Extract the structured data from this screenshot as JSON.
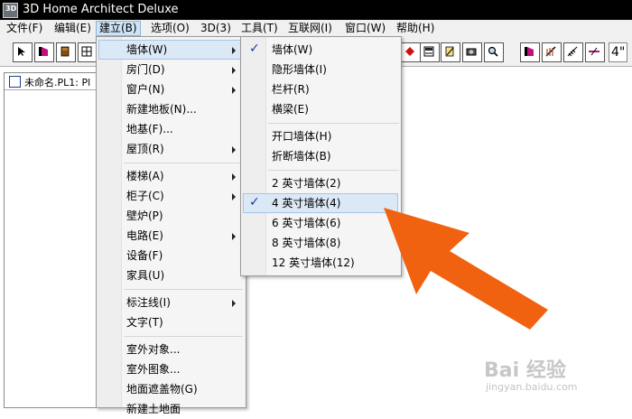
{
  "window": {
    "title": "3D Home Architect Deluxe",
    "icon_text": "3D"
  },
  "menubar": {
    "items": [
      {
        "label": "文件(F)"
      },
      {
        "label": "编辑(E)"
      },
      {
        "label": "建立(B)"
      },
      {
        "label": "选项(O)"
      },
      {
        "label": "3D(3)"
      },
      {
        "label": "工具(T)"
      },
      {
        "label": "互联网(I)"
      },
      {
        "label": "窗口(W)"
      },
      {
        "label": "帮助(H)"
      }
    ],
    "active_index": 2
  },
  "toolbar": {
    "wall_size_text": "4\""
  },
  "document": {
    "title": "未命名.PL1: Pl"
  },
  "build_menu": {
    "items": [
      {
        "label": "墙体(W)"
      },
      {
        "label": "房门(D)"
      },
      {
        "label": "窗户(N)"
      },
      {
        "label": "新建地板(N)..."
      },
      {
        "label": "地基(F)..."
      },
      {
        "label": "屋顶(R)"
      },
      {
        "label": "楼梯(A)"
      },
      {
        "label": "柜子(C)"
      },
      {
        "label": "壁炉(P)"
      },
      {
        "label": "电路(E)"
      },
      {
        "label": "设备(F)"
      },
      {
        "label": "家具(U)"
      },
      {
        "label": "标注线(I)"
      },
      {
        "label": "文字(T)"
      },
      {
        "label": "室外对象..."
      },
      {
        "label": "室外图象..."
      },
      {
        "label": "地面遮盖物(G)"
      },
      {
        "label": "新建土地面"
      }
    ]
  },
  "wall_menu": {
    "items": [
      {
        "label": "墙体(W)"
      },
      {
        "label": "隐形墙体(I)"
      },
      {
        "label": "栏杆(R)"
      },
      {
        "label": "横梁(E)"
      },
      {
        "label": "开口墙体(H)"
      },
      {
        "label": "折断墙体(B)"
      },
      {
        "label": "2 英寸墙体(2)"
      },
      {
        "label": "4 英寸墙体(4)"
      },
      {
        "label": "6 英寸墙体(6)"
      },
      {
        "label": "8 英寸墙体(8)"
      },
      {
        "label": "12 英寸墙体(12)"
      }
    ]
  },
  "watermark": {
    "logo": "Bai 经验",
    "url": "jingyan.baidu.com"
  },
  "colors": {
    "arrow": "#f0620f",
    "highlight": "#dbe8f6",
    "check": "#1a3aa0"
  }
}
